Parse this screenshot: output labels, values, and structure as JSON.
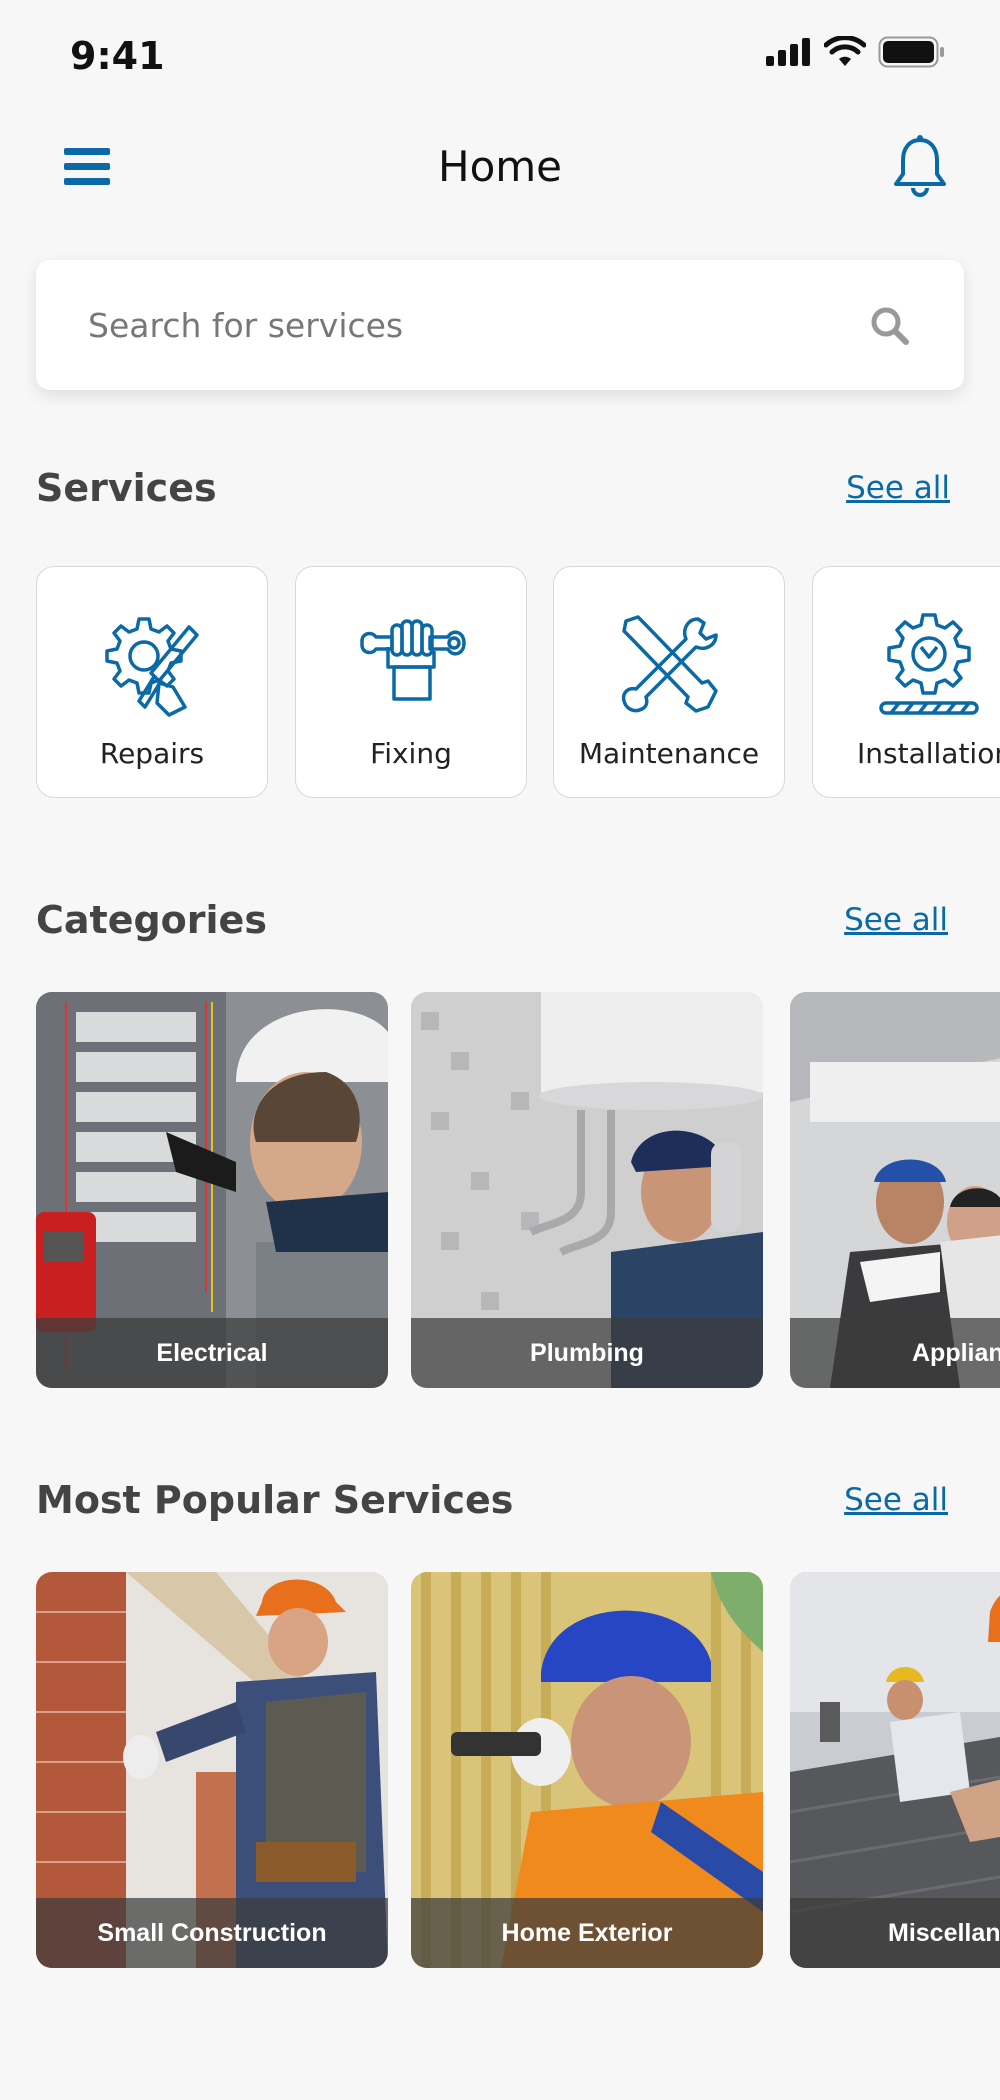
{
  "status_bar": {
    "time": "9:41"
  },
  "header": {
    "title": "Home"
  },
  "search": {
    "placeholder": "Search for services"
  },
  "services": {
    "heading": "Services",
    "see_all": "See all",
    "items": [
      {
        "label": "Repairs",
        "icon": "gear-wrench-hand-icon"
      },
      {
        "label": "Fixing",
        "icon": "fist-wrench-icon"
      },
      {
        "label": "Maintenance",
        "icon": "crossed-tools-icon"
      },
      {
        "label": "Installation",
        "icon": "gear-install-icon"
      }
    ]
  },
  "categories": {
    "heading": "Categories",
    "see_all": "See all",
    "items": [
      {
        "label": "Electrical"
      },
      {
        "label": "Plumbing"
      },
      {
        "label": "Appliances"
      }
    ]
  },
  "popular": {
    "heading": "Most Popular Services",
    "see_all": "See all",
    "items": [
      {
        "label": "Small Construction"
      },
      {
        "label": "Home Exterior"
      },
      {
        "label": "Miscellaneous"
      }
    ]
  },
  "colors": {
    "accent": "#0b6aa6",
    "background": "#f7f7f8",
    "caption_overlay": "#3c3c3c"
  }
}
